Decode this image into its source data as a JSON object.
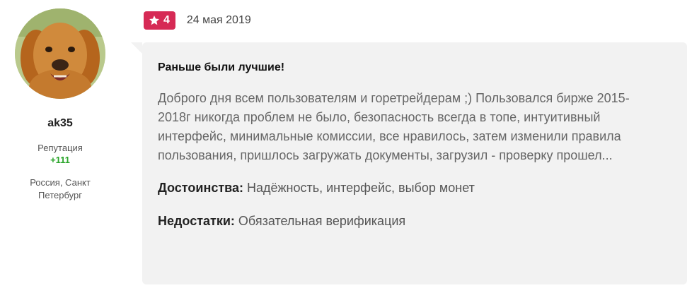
{
  "user": {
    "username": "ak35",
    "reputation_label": "Репутация",
    "reputation_value": "+111",
    "location": "Россия, Санкт Петербург",
    "avatar_icon": "dog-photo-avatar"
  },
  "review": {
    "rating": "4",
    "rating_icon": "star-icon",
    "rating_color": "#d62a55",
    "date": "24 мая 2019",
    "title": "Раньше были лучшие!",
    "body": "Доброго дня всем пользователям и горетрейдерам ;) Пользовался бирже 2015-2018г никогда проблем не было, безопасность всегда в топе, интуитивный интерфейс, минимальные комиссии, все нравилось, затем изменили правила пользования, пришлось загружать документы, загрузил - проверку прошел...",
    "pros_label": "Достоинства:",
    "pros_value": " Надёжность, интерфейс, выбор монет",
    "cons_label": "Недостатки:",
    "cons_value": " Обязательная верификация"
  }
}
